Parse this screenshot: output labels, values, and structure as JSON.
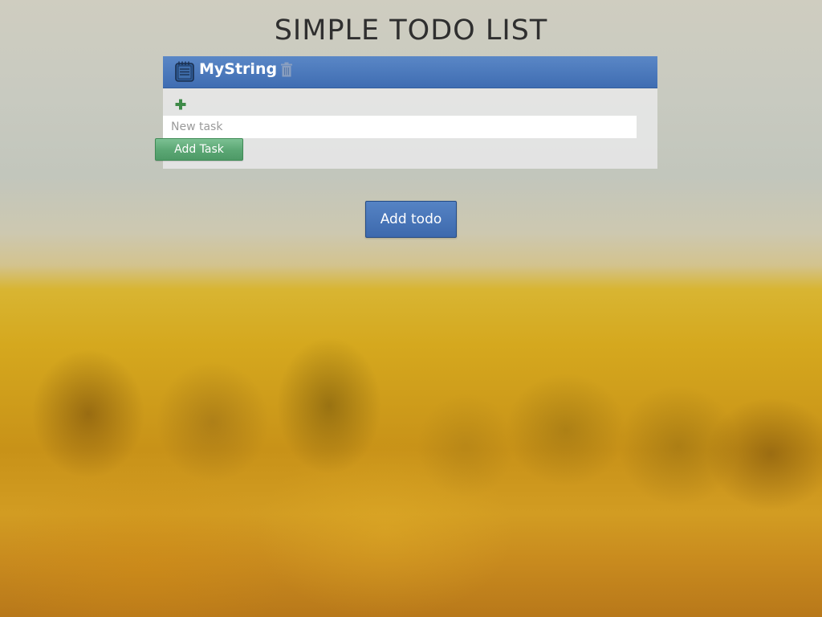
{
  "page": {
    "title": "SIMPLE TODO LIST"
  },
  "todo_list": {
    "name": "MyString",
    "icons": {
      "list_icon": "notepad-icon",
      "delete_icon": "trash-icon",
      "add_icon": "plus-icon"
    },
    "new_task": {
      "placeholder": "New task",
      "value": ""
    },
    "add_task_label": "Add Task"
  },
  "actions": {
    "add_todo_label": "Add todo"
  },
  "colors": {
    "header_blue": "#4a78bc",
    "add_task_green": "#5aa673",
    "add_todo_blue": "#4673b6",
    "plus_green": "#3e8a48"
  }
}
